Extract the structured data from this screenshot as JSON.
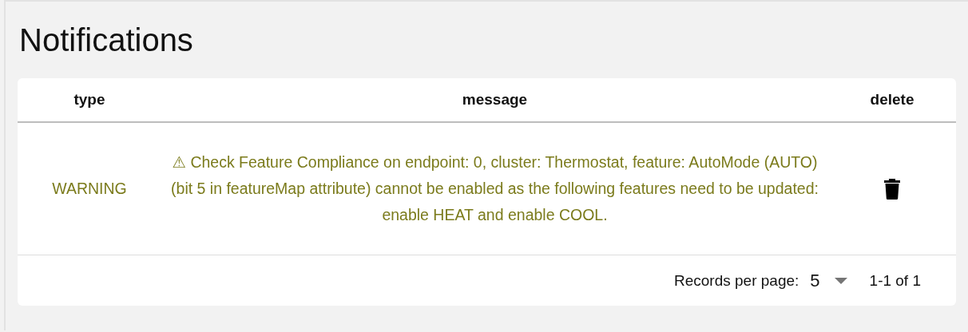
{
  "page": {
    "title": "Notifications"
  },
  "table": {
    "columns": [
      "type",
      "message",
      "delete"
    ],
    "rows": [
      {
        "type": "WARNING",
        "kind": "warning",
        "message": "⚠ Check Feature Compliance on endpoint: 0, cluster: Thermostat, feature: AutoMode (AUTO) (bit 5 in featureMap attribute) cannot be enabled as the following features need to be updated: enable HEAT and enable COOL."
      }
    ]
  },
  "pagination": {
    "label": "Records per page:",
    "per_page": "5",
    "range": "1-1 of 1"
  }
}
